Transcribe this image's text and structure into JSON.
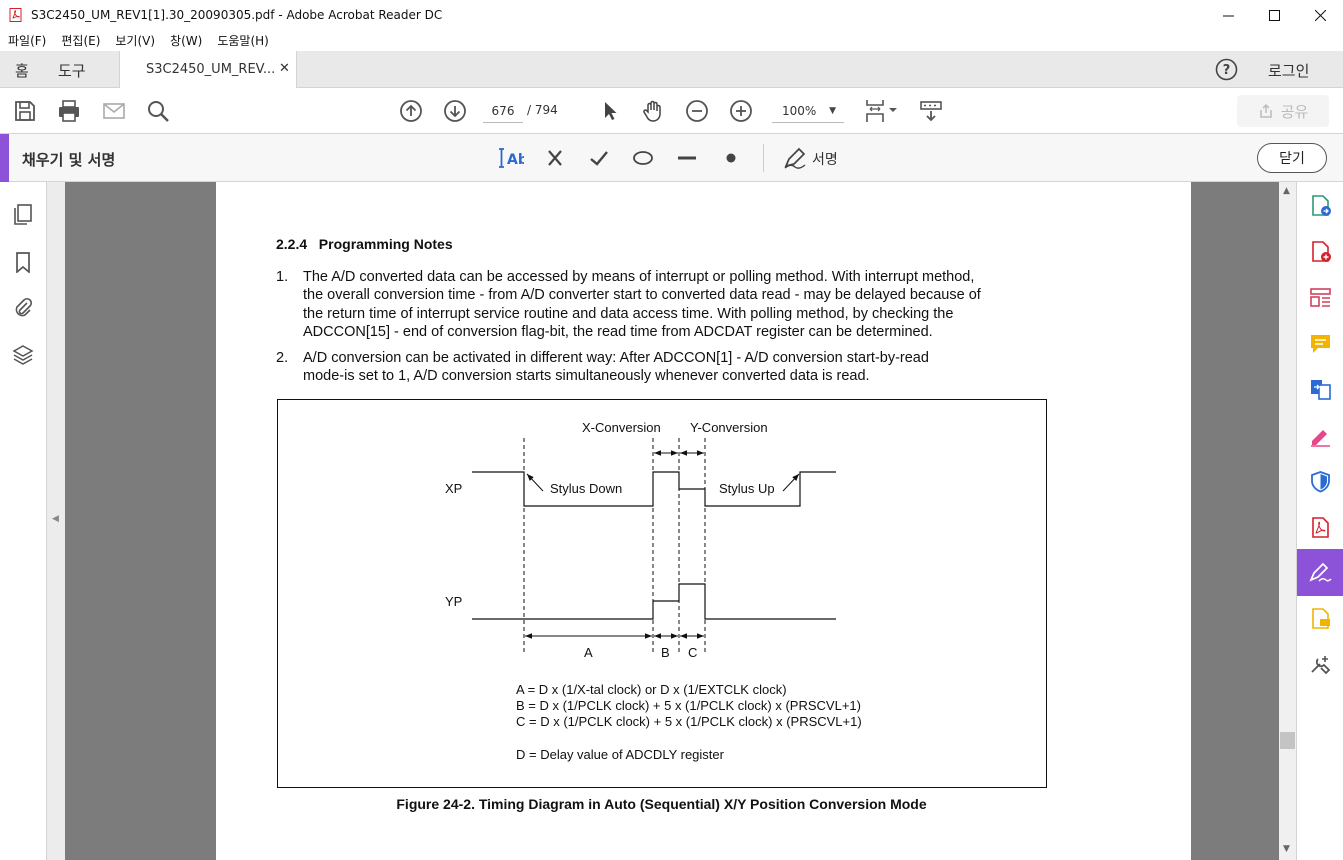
{
  "window": {
    "title": "S3C2450_UM_REV1[1].30_20090305.pdf - Adobe Acrobat Reader DC"
  },
  "menu": [
    "파일(F)",
    "편집(E)",
    "보기(V)",
    "창(W)",
    "도움말(H)"
  ],
  "tabs": {
    "home": "홈",
    "tools": "도구",
    "document": "S3C2450_UM_REV...",
    "login": "로그인"
  },
  "toolbar": {
    "current_page": "676",
    "page_separator": "/ 794",
    "zoom": "100%",
    "share_label": "공유"
  },
  "fill_sign": {
    "title": "채우기 및 서명",
    "sign_label": "서명",
    "close_label": "닫기",
    "accent_color": "#8c52d8"
  },
  "document": {
    "section_heading": "2.2.4   Programming Notes",
    "items": [
      {
        "num": "1.",
        "lines": [
          "The A/D converted data can be accessed by means of interrupt or polling method. With interrupt method,",
          "the overall conversion time - from A/D converter start to converted data read - may be delayed because of",
          "the return time of interrupt service routine and data access time. With polling method, by checking the",
          "ADCCON[15] - end of conversion flag-bit, the read time from ADCDAT register can be determined."
        ]
      },
      {
        "num": "2.",
        "lines": [
          "A/D conversion can be activated in different way: After ADCCON[1] - A/D conversion start-by-read",
          "mode-is set to 1, A/D conversion starts simultaneously whenever converted data is read."
        ]
      }
    ],
    "figure": {
      "x_conversion": "X-Conversion",
      "y_conversion": "Y-Conversion",
      "xp": "XP",
      "yp": "YP",
      "stylus_down": "Stylus Down",
      "stylus_up": "Stylus Up",
      "label_a": "A",
      "label_b": "B",
      "label_c": "C",
      "formula_a": "A = D x (1/X-tal clock) or D x (1/EXTCLK clock)",
      "formula_b": "B = D x (1/PCLK clock) + 5 x (1/PCLK clock) x (PRSCVL+1)",
      "formula_c": "C = D x (1/PCLK clock) + 5 x (1/PCLK clock) x (PRSCVL+1)",
      "formula_d": "D = Delay value of ADCDLY register"
    },
    "caption": "Figure 24-2. Timing Diagram in Auto (Sequential) X/Y Position Conversion Mode"
  }
}
